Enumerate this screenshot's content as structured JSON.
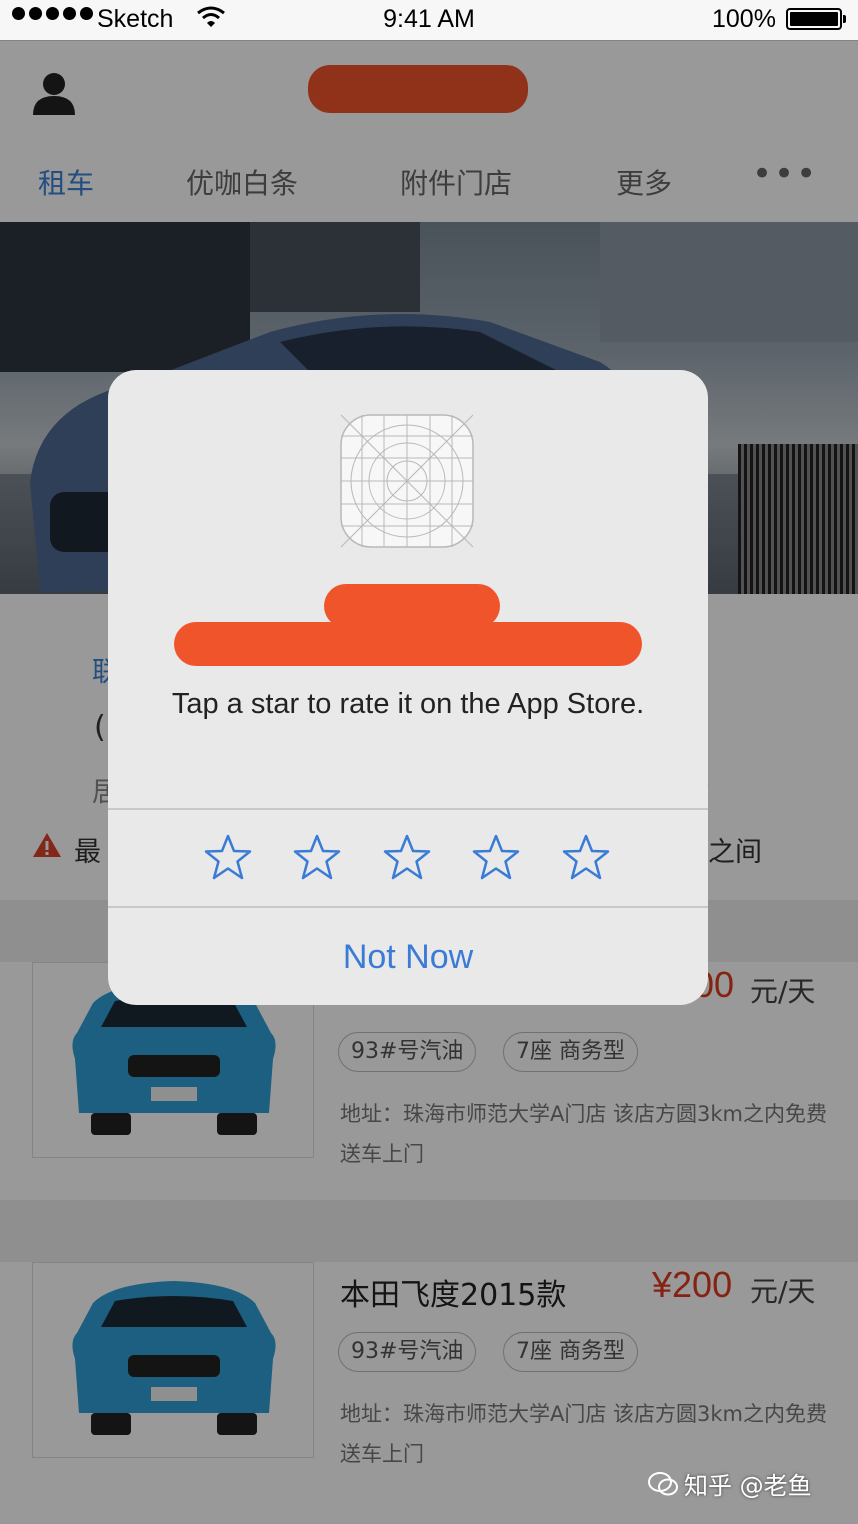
{
  "status_bar": {
    "carrier": "Sketch",
    "time": "9:41 AM",
    "battery_pct": "100%"
  },
  "header": {
    "avatar_icon": "user-icon",
    "title_redacted": true
  },
  "tabs": [
    {
      "label": "租车",
      "active": true
    },
    {
      "label": "优咖白条",
      "active": false
    },
    {
      "label": "附件门店",
      "active": false
    },
    {
      "label": "更多",
      "active": false
    },
    {
      "label": "•••",
      "active": false
    }
  ],
  "info_fragments": {
    "line1": "联",
    "line2": "(",
    "line3": "居",
    "line3_end": ")",
    "warning_start": "最",
    "warning_end": "之间"
  },
  "cars": [
    {
      "name": "",
      "price": "00",
      "unit": "元/天",
      "tags": [
        "93#号汽油",
        "7座 商务型"
      ],
      "address": "地址：珠海市师范大学A门店 该店方圆3km之内免费送车上门"
    },
    {
      "name": "本田飞度2015款",
      "price": "¥200",
      "unit": "元/天",
      "tags": [
        "93#号汽油",
        "7座 商务型"
      ],
      "address": "地址：珠海市师范大学A门店 该店方圆3km之内免费送车上门"
    }
  ],
  "rating_alert": {
    "message": "Tap a star to rate it on the App Store.",
    "star_count": 5,
    "dismiss_label": "Not Now",
    "accent_color": "#3a7bd6"
  },
  "watermark": "知乎 @老鱼"
}
